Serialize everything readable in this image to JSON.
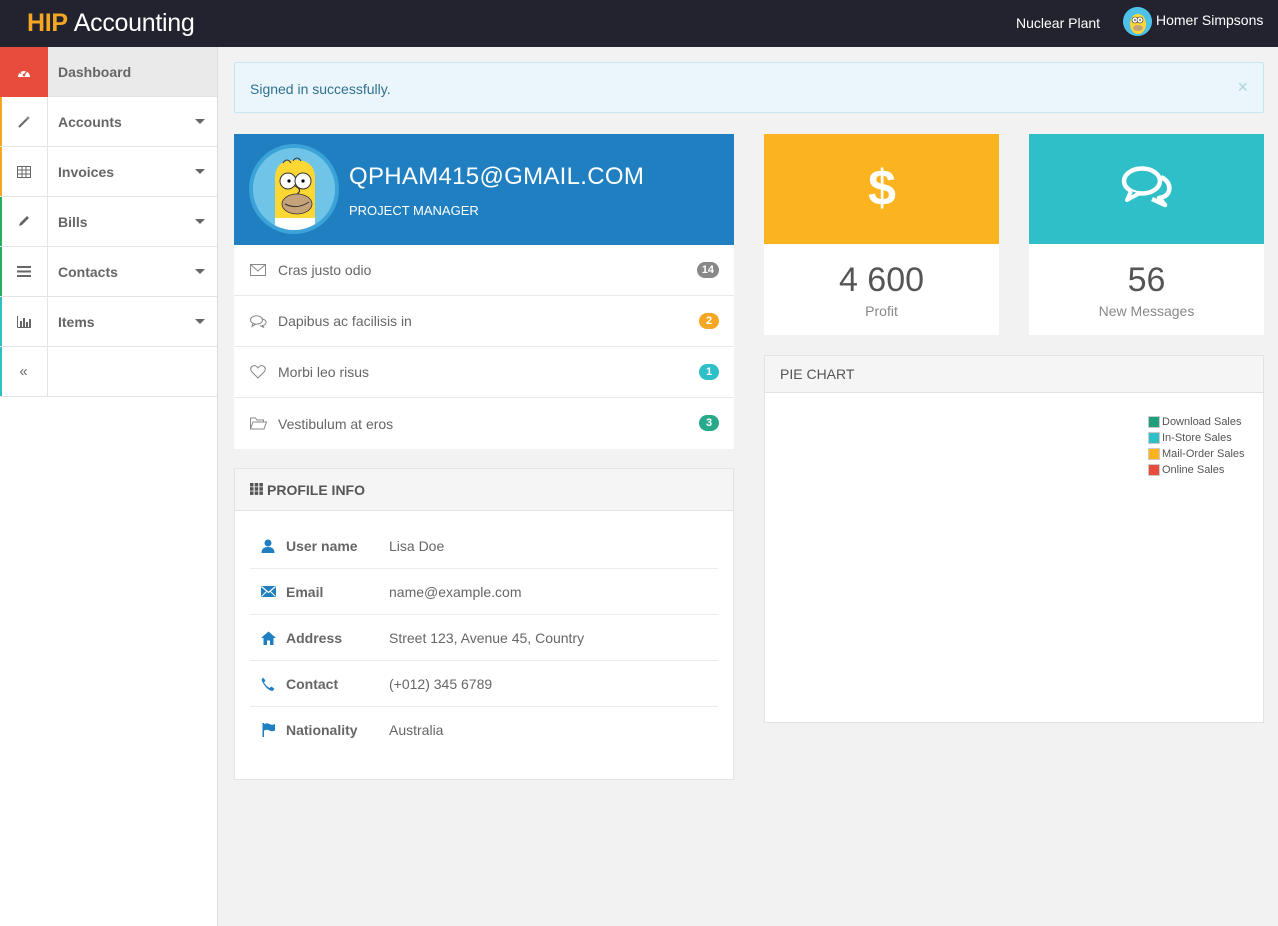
{
  "header": {
    "brand_accent": "HIP",
    "brand_rest": "Accounting",
    "org": "Nuclear Plant",
    "user": "Homer Simpsons"
  },
  "sidebar": {
    "items": [
      {
        "label": "Dashboard",
        "icon": "dashboard-icon",
        "accent": "#e74c3c"
      },
      {
        "label": "Accounts",
        "icon": "magic-wand-icon",
        "accent": "#f5a623"
      },
      {
        "label": "Invoices",
        "icon": "table-icon",
        "accent": "#f5a623"
      },
      {
        "label": "Bills",
        "icon": "pencil-icon",
        "accent": "#27ae60"
      },
      {
        "label": "Contacts",
        "icon": "list-icon",
        "accent": "#27ae60"
      },
      {
        "label": "Items",
        "icon": "bar-chart-icon",
        "accent": "#2fbfc9"
      }
    ],
    "collapse_symbol": "«"
  },
  "alert": {
    "text": "Signed in successfully.",
    "close": "×"
  },
  "profile": {
    "email": "QPHAM415@GMAIL.COM",
    "role": "PROJECT MANAGER",
    "messages": [
      {
        "text": "Cras justo odio",
        "count": "14",
        "color": "#888888",
        "icon": "envelope-icon"
      },
      {
        "text": "Dapibus ac facilisis in",
        "count": "2",
        "color": "#f5a623",
        "icon": "comments-icon"
      },
      {
        "text": "Morbi leo risus",
        "count": "1",
        "color": "#2fbfc9",
        "icon": "heart-icon"
      },
      {
        "text": "Vestibulum at eros",
        "count": "3",
        "color": "#27a98a",
        "icon": "folder-open-icon"
      }
    ]
  },
  "profile_info": {
    "title": "PROFILE INFO",
    "rows": [
      {
        "key": "User name",
        "value": "Lisa Doe",
        "icon": "user-icon"
      },
      {
        "key": "Email",
        "value": "name@example.com",
        "icon": "envelope-icon"
      },
      {
        "key": "Address",
        "value": "Street 123, Avenue 45, Country",
        "icon": "home-icon"
      },
      {
        "key": "Contact",
        "value": "(+012) 345 6789",
        "icon": "phone-icon"
      },
      {
        "key": "Nationality",
        "value": "Australia",
        "icon": "flag-icon"
      }
    ]
  },
  "stats": {
    "profit": {
      "value": "4 600",
      "label": "Profit",
      "icon": "dollar-icon",
      "color": "#fbb41f"
    },
    "messages": {
      "value": "56",
      "label": "New Messages",
      "icon": "comments-icon",
      "color": "#2fbfc9"
    }
  },
  "pie": {
    "title": "PIE CHART",
    "legend": [
      {
        "label": "Download Sales",
        "color": "#1f9e7b"
      },
      {
        "label": "In-Store Sales",
        "color": "#2fbfc9"
      },
      {
        "label": "Mail-Order Sales",
        "color": "#fbb41f"
      },
      {
        "label": "Online Sales",
        "color": "#e74c3c"
      }
    ]
  }
}
